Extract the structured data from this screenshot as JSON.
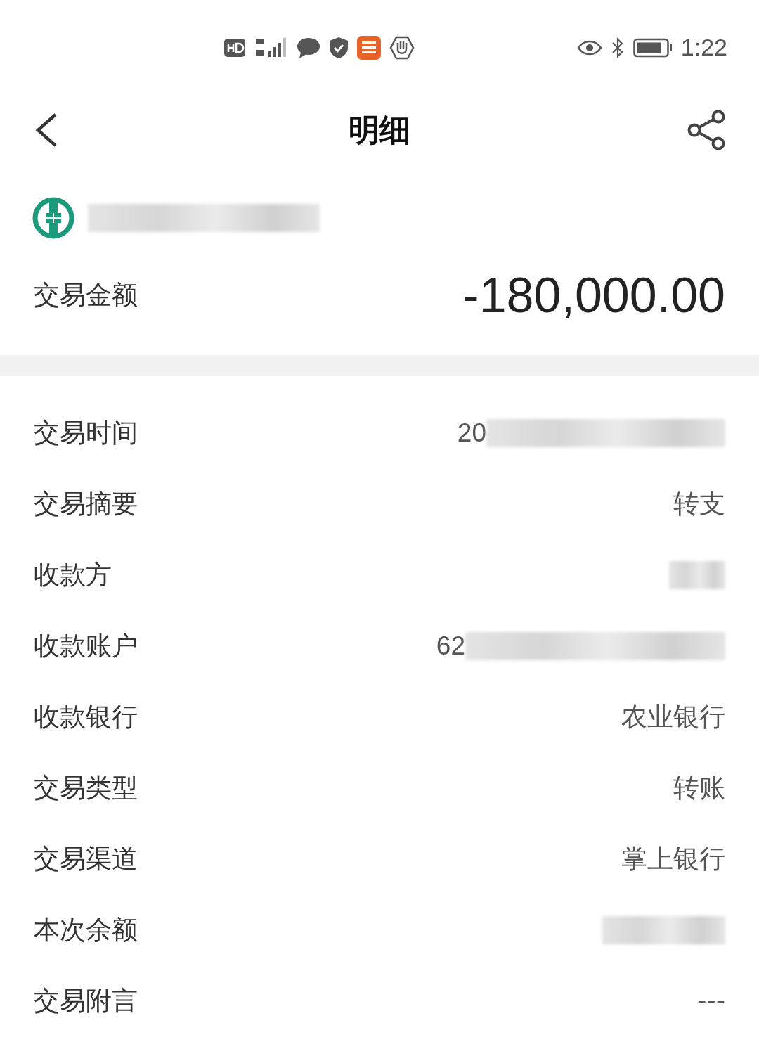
{
  "status_bar": {
    "time": "1:22"
  },
  "header": {
    "title": "明细"
  },
  "account": {
    "kind": "hidden"
  },
  "amount": {
    "label": "交易金额",
    "value": "-180,000.00"
  },
  "rows": [
    {
      "label": "交易时间",
      "kind": "partly_hidden",
      "value": "20"
    },
    {
      "label": "交易摘要",
      "kind": "text",
      "value": "转支"
    },
    {
      "label": "收款方",
      "kind": "hidden"
    },
    {
      "label": "收款账户",
      "kind": "partly_hidden",
      "value": "62"
    },
    {
      "label": "收款银行",
      "kind": "text",
      "value": "农业银行"
    },
    {
      "label": "交易类型",
      "kind": "text",
      "value": "转账"
    },
    {
      "label": "交易渠道",
      "kind": "text",
      "value": "掌上银行"
    },
    {
      "label": "本次余额",
      "kind": "hidden"
    },
    {
      "label": "交易附言",
      "kind": "text",
      "value": "---"
    }
  ]
}
